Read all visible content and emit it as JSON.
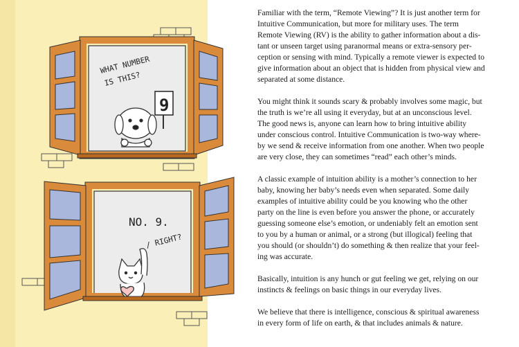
{
  "illustration": {
    "top_window": {
      "caption_lines": [
        "WHAT NUMBER",
        "IS THIS?"
      ],
      "sign_value": "9"
    },
    "bottom_window": {
      "caption_lines": [
        "NO. 9.",
        "/ RIGHT?"
      ]
    }
  },
  "article": {
    "paragraphs": [
      {
        "lines": [
          "Familiar with the term, “Remote Viewing”? It is just another term for",
          "Intuitive Communication, but more for military uses. The term",
          "Remote Viewing (RV) is the ability to gather information about a dis-",
          "tant or unseen target using paranormal means or extra-sensory per-",
          "ception or sensing with mind. Typically a remote viewer is expected to",
          "give information about an object that is hidden from physical view and",
          "separated at some distance."
        ]
      },
      {
        "lines": [
          "You might think it sounds scary & probably involves some magic, but",
          "the truth is we’re all using it everyday, but at an unconscious level.",
          "The good news is, anyone can learn how to bring intuitive ability",
          "under conscious control. Intuitive Communication is two-way where-",
          "by we send & receive information from one another. When two people",
          "are very close, they can sometimes “read” each other’s minds."
        ]
      },
      {
        "lines": [
          "A classic example of intuition ability is a mother’s connection to her",
          "baby, knowing her baby’s needs even when separated. Some daily",
          "examples of intuitive ability could be you knowing who the other",
          "party on the line is even before you answer the phone, or accurately",
          "guessing someone else’s emotion, or undeniably felt an emotion sent",
          "to you by a human or animal, or a strong (but illogical) feeling that",
          "you should (or shouldn’t) do something & then realize that your feel-",
          "ing was accurate."
        ]
      },
      {
        "lines": [
          "Basically, intuition is any hunch or gut feeling we get, relying on our",
          "instincts & feelings on basic things in our everyday lives."
        ]
      },
      {
        "lines": [
          "We believe that there is intelligence, conscious & spiritual awareness",
          "in every form of life on earth, & that includes animals & nature."
        ]
      }
    ]
  },
  "colors": {
    "wall": "#fbefb8",
    "window_frame": "#d98a3a",
    "window_frame_dark": "#b8691f",
    "glass": "#aab7dd",
    "room": "#ececec",
    "text": "#1a1a1a"
  }
}
